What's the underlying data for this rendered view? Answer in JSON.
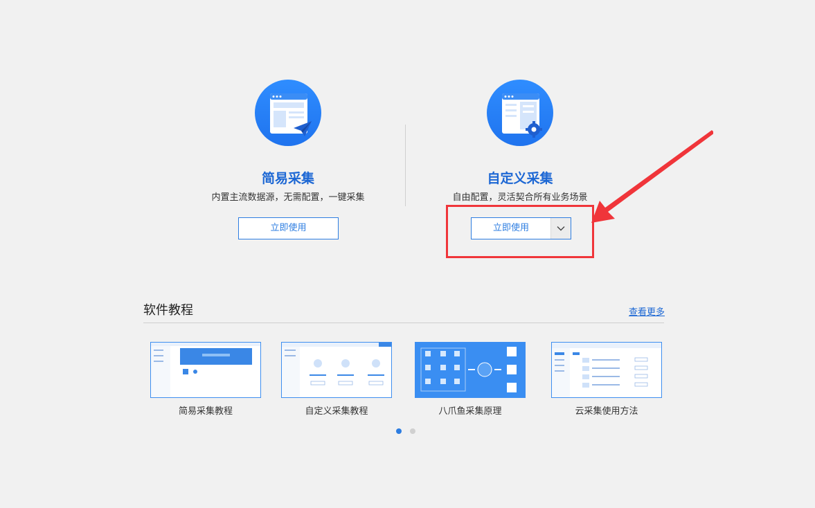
{
  "modes": {
    "simple": {
      "title": "简易采集",
      "description": "内置主流数据源，无需配置，一键采集",
      "button_label": "立即使用",
      "icon": "browser-paper-plane-icon"
    },
    "custom": {
      "title": "自定义采集",
      "description": "自由配置，灵活契合所有业务场景",
      "button_label": "立即使用",
      "icon": "browser-gear-icon"
    }
  },
  "tutorials": {
    "title": "软件教程",
    "see_more": "查看更多",
    "items": [
      {
        "label": "简易采集教程"
      },
      {
        "label": "自定义采集教程"
      },
      {
        "label": "八爪鱼采集原理"
      },
      {
        "label": "云采集使用方法"
      }
    ],
    "page_count": 2,
    "active_page": 1
  },
  "colors": {
    "accent": "#2d7de1",
    "title_blue": "#1c67d4",
    "annotation_red": "#f0353a",
    "background": "#f1f1f1"
  }
}
